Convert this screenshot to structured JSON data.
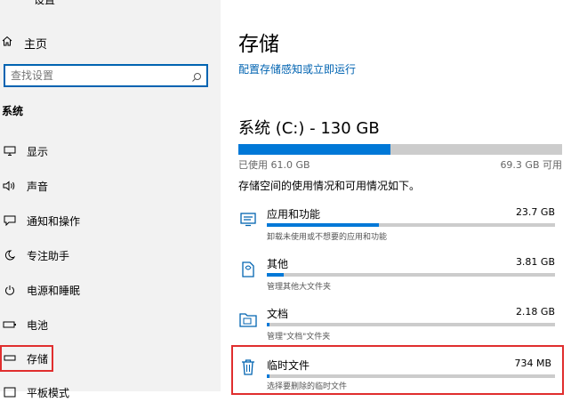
{
  "window": {
    "title": "设置"
  },
  "sidebar": {
    "home_label": "主页",
    "search_placeholder": "查找设置",
    "section_title": "系统",
    "items": [
      {
        "label": "显示",
        "icon": "display-icon"
      },
      {
        "label": "声音",
        "icon": "speaker-icon"
      },
      {
        "label": "通知和操作",
        "icon": "notification-icon"
      },
      {
        "label": "专注助手",
        "icon": "moon-icon"
      },
      {
        "label": "电源和睡眠",
        "icon": "power-icon"
      },
      {
        "label": "电池",
        "icon": "battery-icon"
      },
      {
        "label": "存储",
        "icon": "storage-icon",
        "selected": true
      },
      {
        "label": "平板模式",
        "icon": "tablet-icon"
      }
    ]
  },
  "main": {
    "title": "存储",
    "link": "配置存储感知或立即运行",
    "drive_title": "系统 (C:) - 130 GB",
    "used_label": "已使用 61.0 GB",
    "available_label": "69.3 GB 可用",
    "used_fraction": 0.47,
    "description": "存储空间的使用情况和可用情况如下。",
    "categories": [
      {
        "name": "应用和功能",
        "size": "23.7 GB",
        "sub": "卸载未使用或不想要的应用和功能",
        "icon": "apps-icon",
        "fraction": 0.39
      },
      {
        "name": "其他",
        "size": "3.81 GB",
        "sub": "管理其他大文件夹",
        "icon": "other-files-icon",
        "fraction": 0.06
      },
      {
        "name": "文档",
        "size": "2.18 GB",
        "sub": "管理\"文档\"文件夹",
        "icon": "documents-icon",
        "fraction": 0.01
      },
      {
        "name": "临时文件",
        "size": "734 MB",
        "sub": "选择要删除的临时文件",
        "icon": "trash-icon",
        "fraction": 0.01,
        "highlighted": true
      }
    ]
  },
  "colors": {
    "accent": "#0078d7",
    "highlight_border": "#e02e2e",
    "link": "#0063b1"
  }
}
